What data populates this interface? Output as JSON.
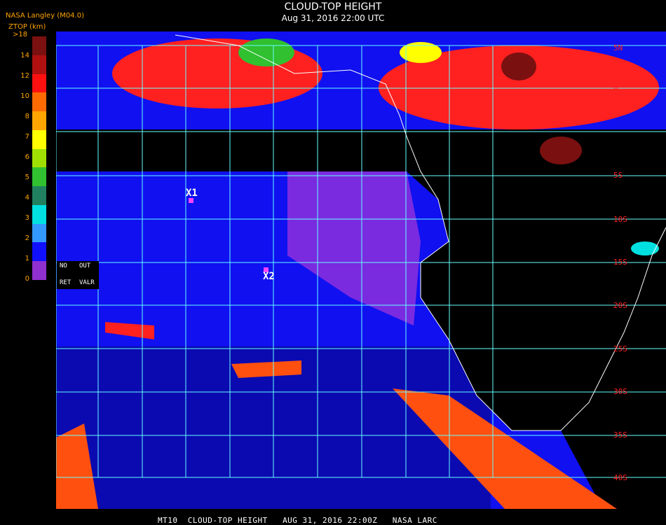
{
  "header": {
    "title": "CLOUD-TOP HEIGHT",
    "datetime": "Aug 31, 2016 22:00 UTC",
    "org": "NASA Langley (M04.0)",
    "units": "ZTOP (km)"
  },
  "legend": {
    "top_label": ">18",
    "labels": [
      "14",
      "12",
      "10",
      "8",
      "7",
      "6",
      "5",
      "4",
      "3",
      "2",
      "1",
      "0"
    ],
    "colors": [
      "#7a1010",
      "#b01010",
      "#ff1010",
      "#ff6a00",
      "#ffa500",
      "#ffff00",
      "#a0e000",
      "#30c030",
      "#208060",
      "#00e0e0",
      "#3399ff",
      "#1010ff",
      "#9030d0"
    ]
  },
  "status_panel": {
    "no": "NO",
    "out": "OUT",
    "ret": "RET",
    "valr": "VALR"
  },
  "markers": [
    {
      "label": "X1"
    },
    {
      "label": "X2"
    }
  ],
  "lat_labels": [
    "5N",
    "0",
    "5S",
    "10S",
    "15S",
    "20S",
    "25S",
    "30S",
    "35S",
    "40S"
  ],
  "footer": "MT10  CLOUD-TOP HEIGHT   AUG 31, 2016 22:00Z   NASA LARC"
}
